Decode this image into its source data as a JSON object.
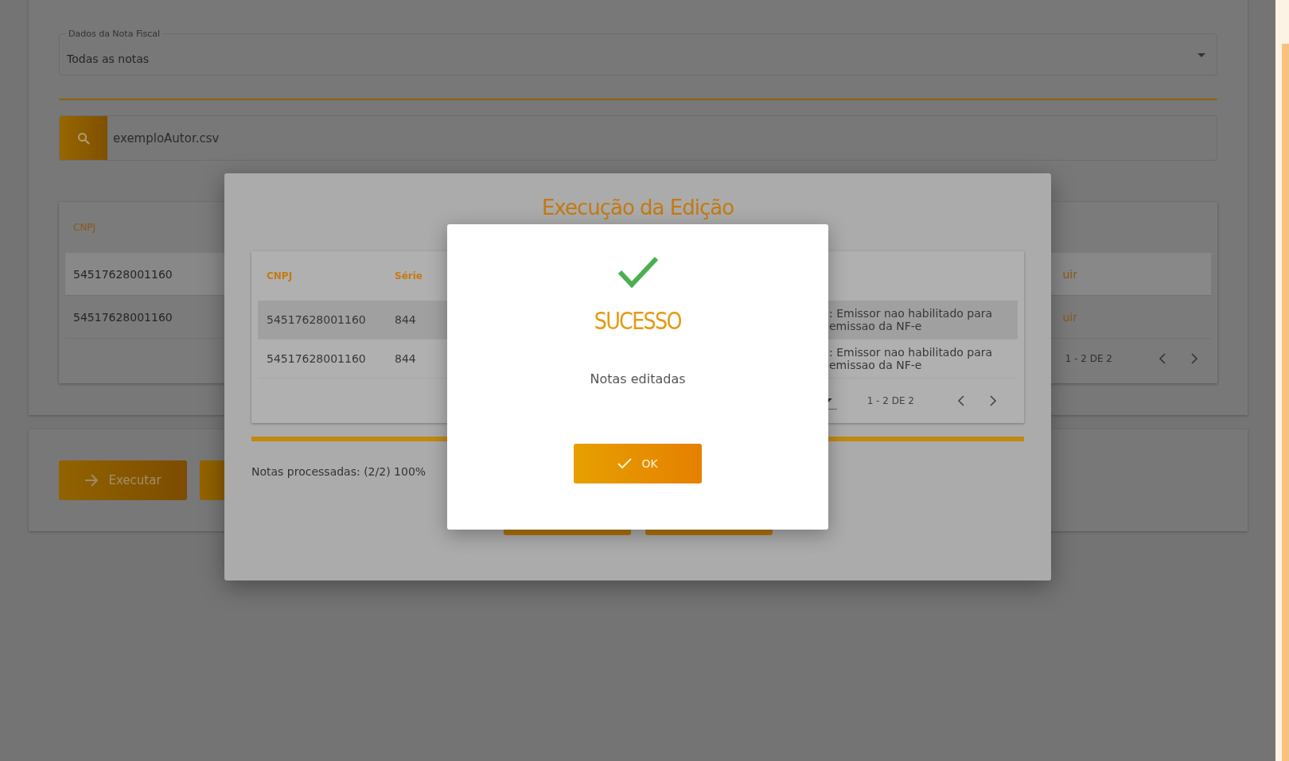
{
  "page": {
    "filter": {
      "label": "Dados da Nota Fiscal",
      "value": "Todas as notas"
    },
    "search": {
      "value": "exemploAutor.csv"
    },
    "table": {
      "columns": [
        "CNPJ"
      ],
      "rows": [
        {
          "cnpj": "54517628001160",
          "action": "uir",
          "highlighted": true
        },
        {
          "cnpj": "54517628001160",
          "action": "uir",
          "highlighted": false
        }
      ],
      "pagination": "1 - 2 DE 2"
    },
    "buttons": [
      {
        "kind": "execute",
        "label": "Executar"
      },
      {
        "kind": "covered"
      }
    ]
  },
  "edit_dialog": {
    "title": "Execução da Edição",
    "table": {
      "columns": [
        "CNPJ",
        "Série"
      ],
      "rows": [
        {
          "cnpj": "54517628001160",
          "serie": "844",
          "message": ": Emissor nao habilitado para emissao da NF-e",
          "highlighted": true
        },
        {
          "cnpj": "54517628001160",
          "serie": "844",
          "message": ": Emissor nao habilitado para emissao da NF-e",
          "highlighted": false
        }
      ],
      "pagination": "1 - 2 DE 2"
    },
    "progress": {
      "level": 1
    },
    "status": "Notas processadas: (2/2) 100%"
  },
  "success_dialog": {
    "title": "SUCESSO",
    "message": "Notas editadas",
    "button": "OK"
  }
}
